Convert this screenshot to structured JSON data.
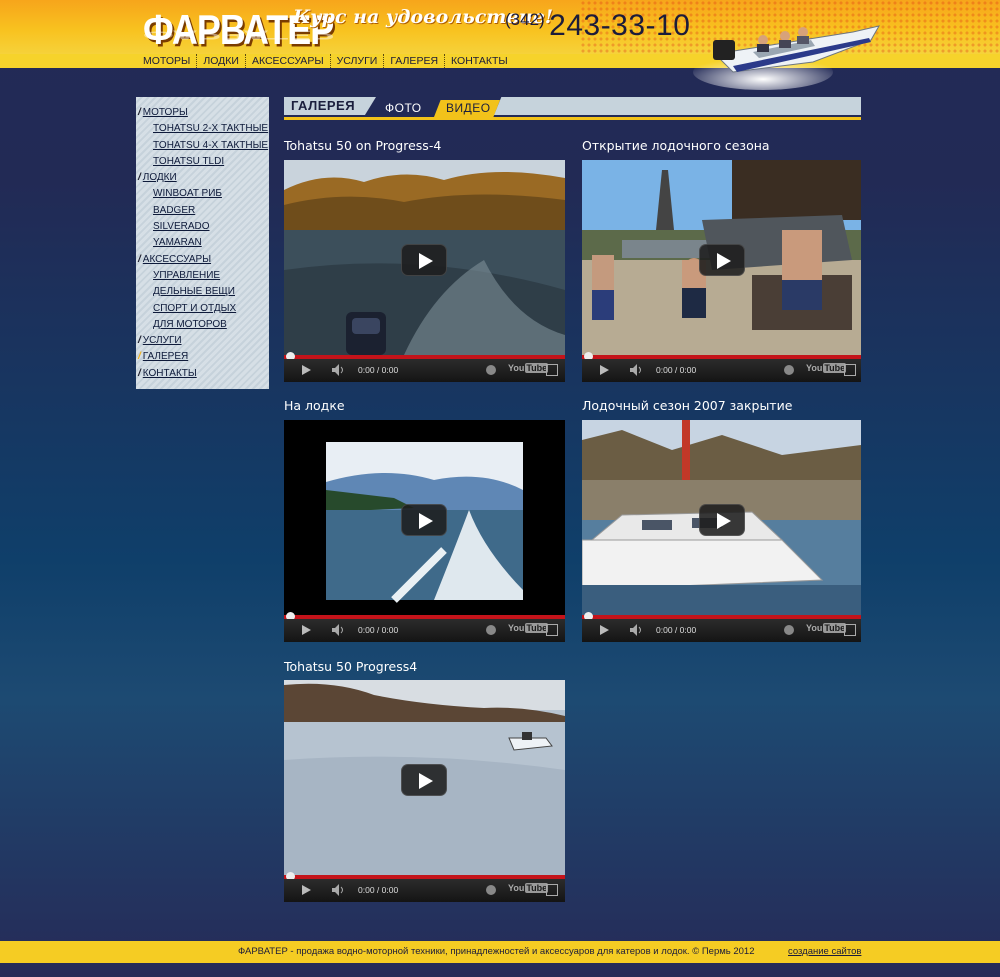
{
  "header": {
    "logo": "ФАРВАТЕР",
    "slogan": "Курс на удовольствие!",
    "phone_code": "(342)",
    "phone_number": "243-33-10"
  },
  "nav": [
    {
      "label": "МОТОРЫ"
    },
    {
      "label": "ЛОДКИ"
    },
    {
      "label": "АКСЕССУАРЫ"
    },
    {
      "label": "УСЛУГИ"
    },
    {
      "label": "ГАЛЕРЕЯ"
    },
    {
      "label": "КОНТАКТЫ"
    }
  ],
  "sidebar": {
    "items": [
      {
        "label": "МОТОРЫ",
        "level": "top"
      },
      {
        "label": "TOHATSU 2-Х ТАКТНЫЕ",
        "level": "sub"
      },
      {
        "label": "TOHATSU 4-Х ТАКТНЫЕ",
        "level": "sub"
      },
      {
        "label": "TOHATSU TLDI",
        "level": "sub"
      },
      {
        "label": "ЛОДКИ",
        "level": "top"
      },
      {
        "label": "WINBOAT РИБ",
        "level": "sub"
      },
      {
        "label": "BADGER",
        "level": "sub"
      },
      {
        "label": "SILVERADO",
        "level": "sub"
      },
      {
        "label": "YAMARAN",
        "level": "sub"
      },
      {
        "label": "АКСЕССУАРЫ",
        "level": "top"
      },
      {
        "label": "УПРАВЛЕНИЕ",
        "level": "sub"
      },
      {
        "label": "ДЕЛЬНЫЕ ВЕЩИ",
        "level": "sub"
      },
      {
        "label": "СПОРТ И ОТДЫХ",
        "level": "sub"
      },
      {
        "label": "ДЛЯ МОТОРОВ",
        "level": "sub"
      },
      {
        "label": "УСЛУГИ",
        "level": "top"
      },
      {
        "label": "ГАЛЕРЕЯ",
        "level": "top",
        "active": true
      },
      {
        "label": "КОНТАКТЫ",
        "level": "top"
      }
    ]
  },
  "tabs": {
    "gallery": "ГАЛЕРЕЯ",
    "photo": "ФОТО",
    "video": "ВИДЕО"
  },
  "videos": [
    {
      "title": "Tohatsu 50 on Progress-4",
      "time": "0:00 / 0:00"
    },
    {
      "title": "Открытие лодочного сезона",
      "time": "0:00 / 0:00"
    },
    {
      "title": "На лодке",
      "time": "0:00 / 0:00"
    },
    {
      "title": "Лодочный сезон 2007 закрытие",
      "time": "0:00 / 0:00"
    },
    {
      "title": "Tohatsu 50 Progress4",
      "time": "0:00 / 0:00"
    }
  ],
  "player": {
    "you": "You",
    "tube": "Tube"
  },
  "footer": {
    "copyright": "ФАРВАТЕР - продажа водно-моторной техники, принадлежностей и аксессуаров для катеров и лодок. © Пермь 2012",
    "link": "создание сайтов"
  },
  "colors": {
    "accent_yellow": "#f5cc23",
    "header_orange": "#f7a51b",
    "background_navy": "#232a57",
    "progress_red": "#c4131a"
  }
}
